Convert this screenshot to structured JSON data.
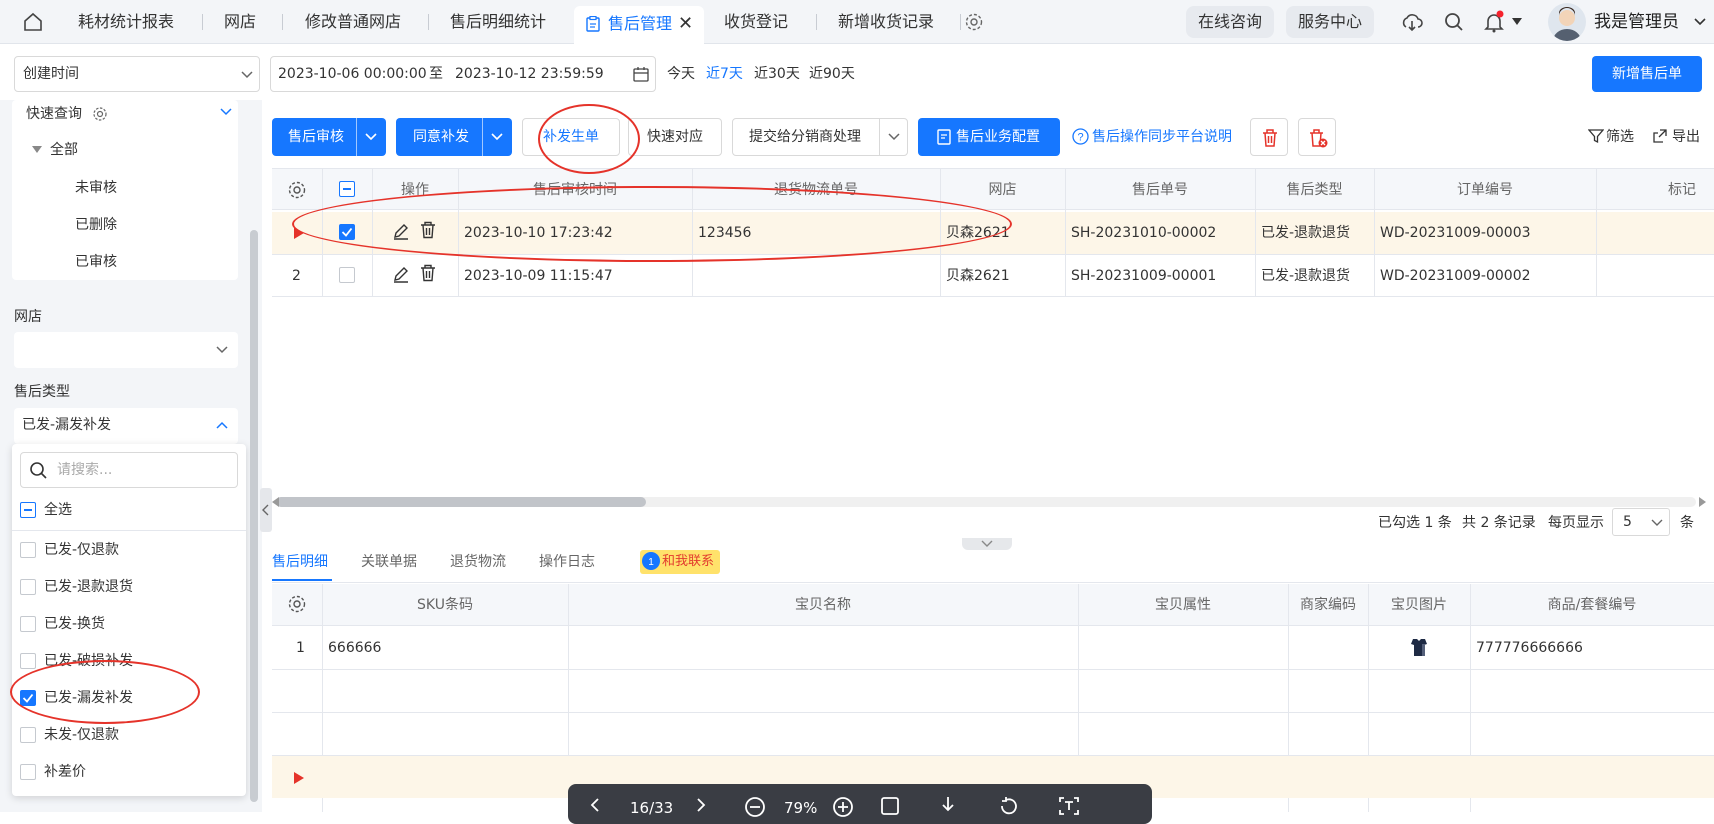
{
  "tabs": {
    "items": [
      {
        "label": "耗材统计报表"
      },
      {
        "label": "网店"
      },
      {
        "label": "修改普通网店"
      },
      {
        "label": "售后明细统计"
      },
      {
        "label": "售后管理"
      },
      {
        "label": "收货登记"
      },
      {
        "label": "新增收货记录"
      }
    ],
    "active_close": "✕"
  },
  "header": {
    "online_consult": "在线咨询",
    "service_center": "服务中心",
    "username": "我是管理员"
  },
  "filter": {
    "date_field": "创建时间",
    "start": "2023-10-06 00:00:00",
    "to": "至",
    "end": "2023-10-12 23:59:59",
    "ranges": [
      "今天",
      "近7天",
      "近30天",
      "近90天"
    ],
    "new_button": "新增售后单"
  },
  "sidebar": {
    "quick_query": "快速查询",
    "tree_root": "全部",
    "tree_items": [
      "未审核",
      "已删除",
      "已审核"
    ],
    "shop_label": "网店",
    "type_label": "售后类型",
    "type_value": "已发-漏发补发",
    "search_placeholder": "请搜索...",
    "select_all": "全选",
    "options": [
      "已发-仅退款",
      "已发-退款退货",
      "已发-换货",
      "已发-破损补发",
      "已发-漏发补发",
      "未发-仅退款",
      "补差价"
    ]
  },
  "toolbar": {
    "audit": "售后审核",
    "agree_resend": "同意补发",
    "resend_create": "补发生单",
    "quick_match": "快速对应",
    "submit_distributor": "提交给分销商处理",
    "biz_config": "售后业务配置",
    "sync_help": "售后操作同步平台说明",
    "filter": "筛选",
    "export": "导出"
  },
  "table": {
    "headers": [
      "操作",
      "售后审核时间",
      "退货物流单号",
      "网店",
      "售后单号",
      "售后类型",
      "订单编号",
      "标记"
    ],
    "rows": [
      {
        "index": "",
        "audit_time": "2023-10-10 17:23:42",
        "return_no": "123456",
        "shop": "贝森2621",
        "as_no": "SH-20231010-00002",
        "as_type": "已发-退款退货",
        "order_no": "WD-20231009-00003"
      },
      {
        "index": "2",
        "audit_time": "2023-10-09 11:15:47",
        "return_no": "",
        "shop": "贝森2621",
        "as_no": "SH-20231009-00001",
        "as_type": "已发-退款退货",
        "order_no": "WD-20231009-00002"
      }
    ],
    "pager": {
      "selected": "已勾选 1 条",
      "total": "共 2 条记录",
      "per_page_label": "每页显示",
      "per_page": "5",
      "unit": "条"
    }
  },
  "detail": {
    "tabs": [
      "售后明细",
      "关联单据",
      "退货物流",
      "操作日志"
    ],
    "contact": "和我联系",
    "headers": [
      "SKU条码",
      "宝贝名称",
      "宝贝属性",
      "商家编码",
      "宝贝图片",
      "商品/套餐编号"
    ],
    "rows": [
      {
        "index": "1",
        "sku": "666666",
        "code": "777776666666"
      }
    ]
  },
  "viewer": {
    "page": "16/33",
    "zoom": "79%"
  },
  "colors": {
    "accent": "#1677ff",
    "highlight": "#e5332a"
  }
}
